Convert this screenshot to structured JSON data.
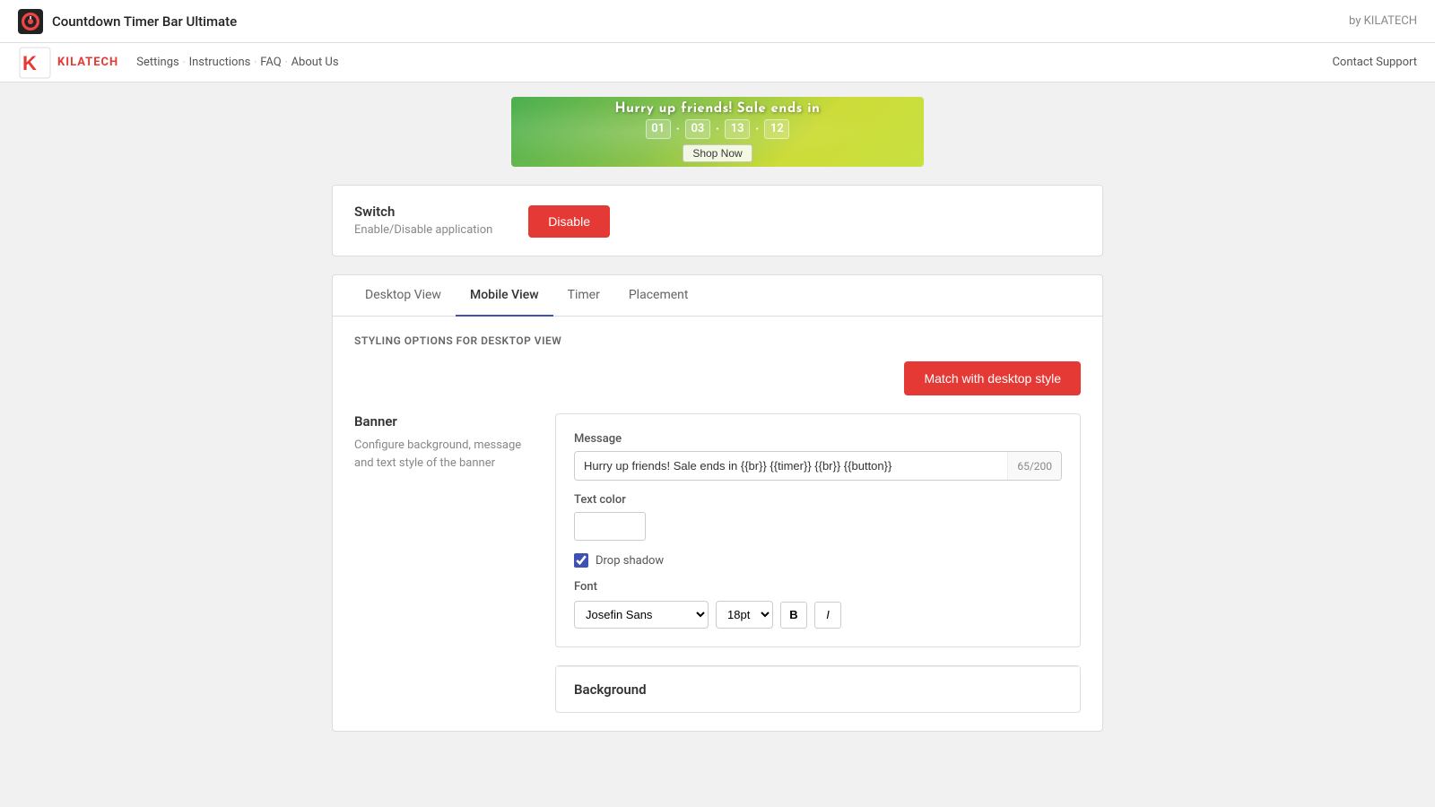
{
  "app": {
    "title": "Countdown Timer Bar Ultimate",
    "by": "by KILATECH"
  },
  "nav": {
    "links": [
      "Settings",
      "Instructions",
      "FAQ",
      "About Us"
    ],
    "contact": "Contact Support"
  },
  "logo": {
    "text": "KILATECH"
  },
  "banner": {
    "text": "Hurry up friends! Sale ends in",
    "timer": [
      "01",
      "03",
      "13",
      "12"
    ],
    "button": "Shop Now"
  },
  "switch_section": {
    "title": "Switch",
    "description": "Enable/Disable application",
    "button": "Disable"
  },
  "tabs": {
    "items": [
      "Desktop View",
      "Mobile View",
      "Timer",
      "Placement"
    ],
    "active": 1
  },
  "styling": {
    "section_label": "STYLING OPTIONS FOR DESKTOP VIEW",
    "match_button": "Match with desktop style",
    "banner": {
      "title": "Banner",
      "description": "Configure background, message and text style of the banner"
    },
    "message": {
      "label": "Message",
      "value": "Hurry up friends! Sale ends in {{br}} {{timer}} {{br}} {{button}}",
      "char_count": "65/200"
    },
    "text_color": {
      "label": "Text color"
    },
    "drop_shadow": {
      "label": "Drop shadow",
      "checked": true
    },
    "font": {
      "label": "Font",
      "family": "Josefin Sans",
      "size": "18pt",
      "bold": "B",
      "italic": "I"
    },
    "background": {
      "title": "Background"
    }
  }
}
